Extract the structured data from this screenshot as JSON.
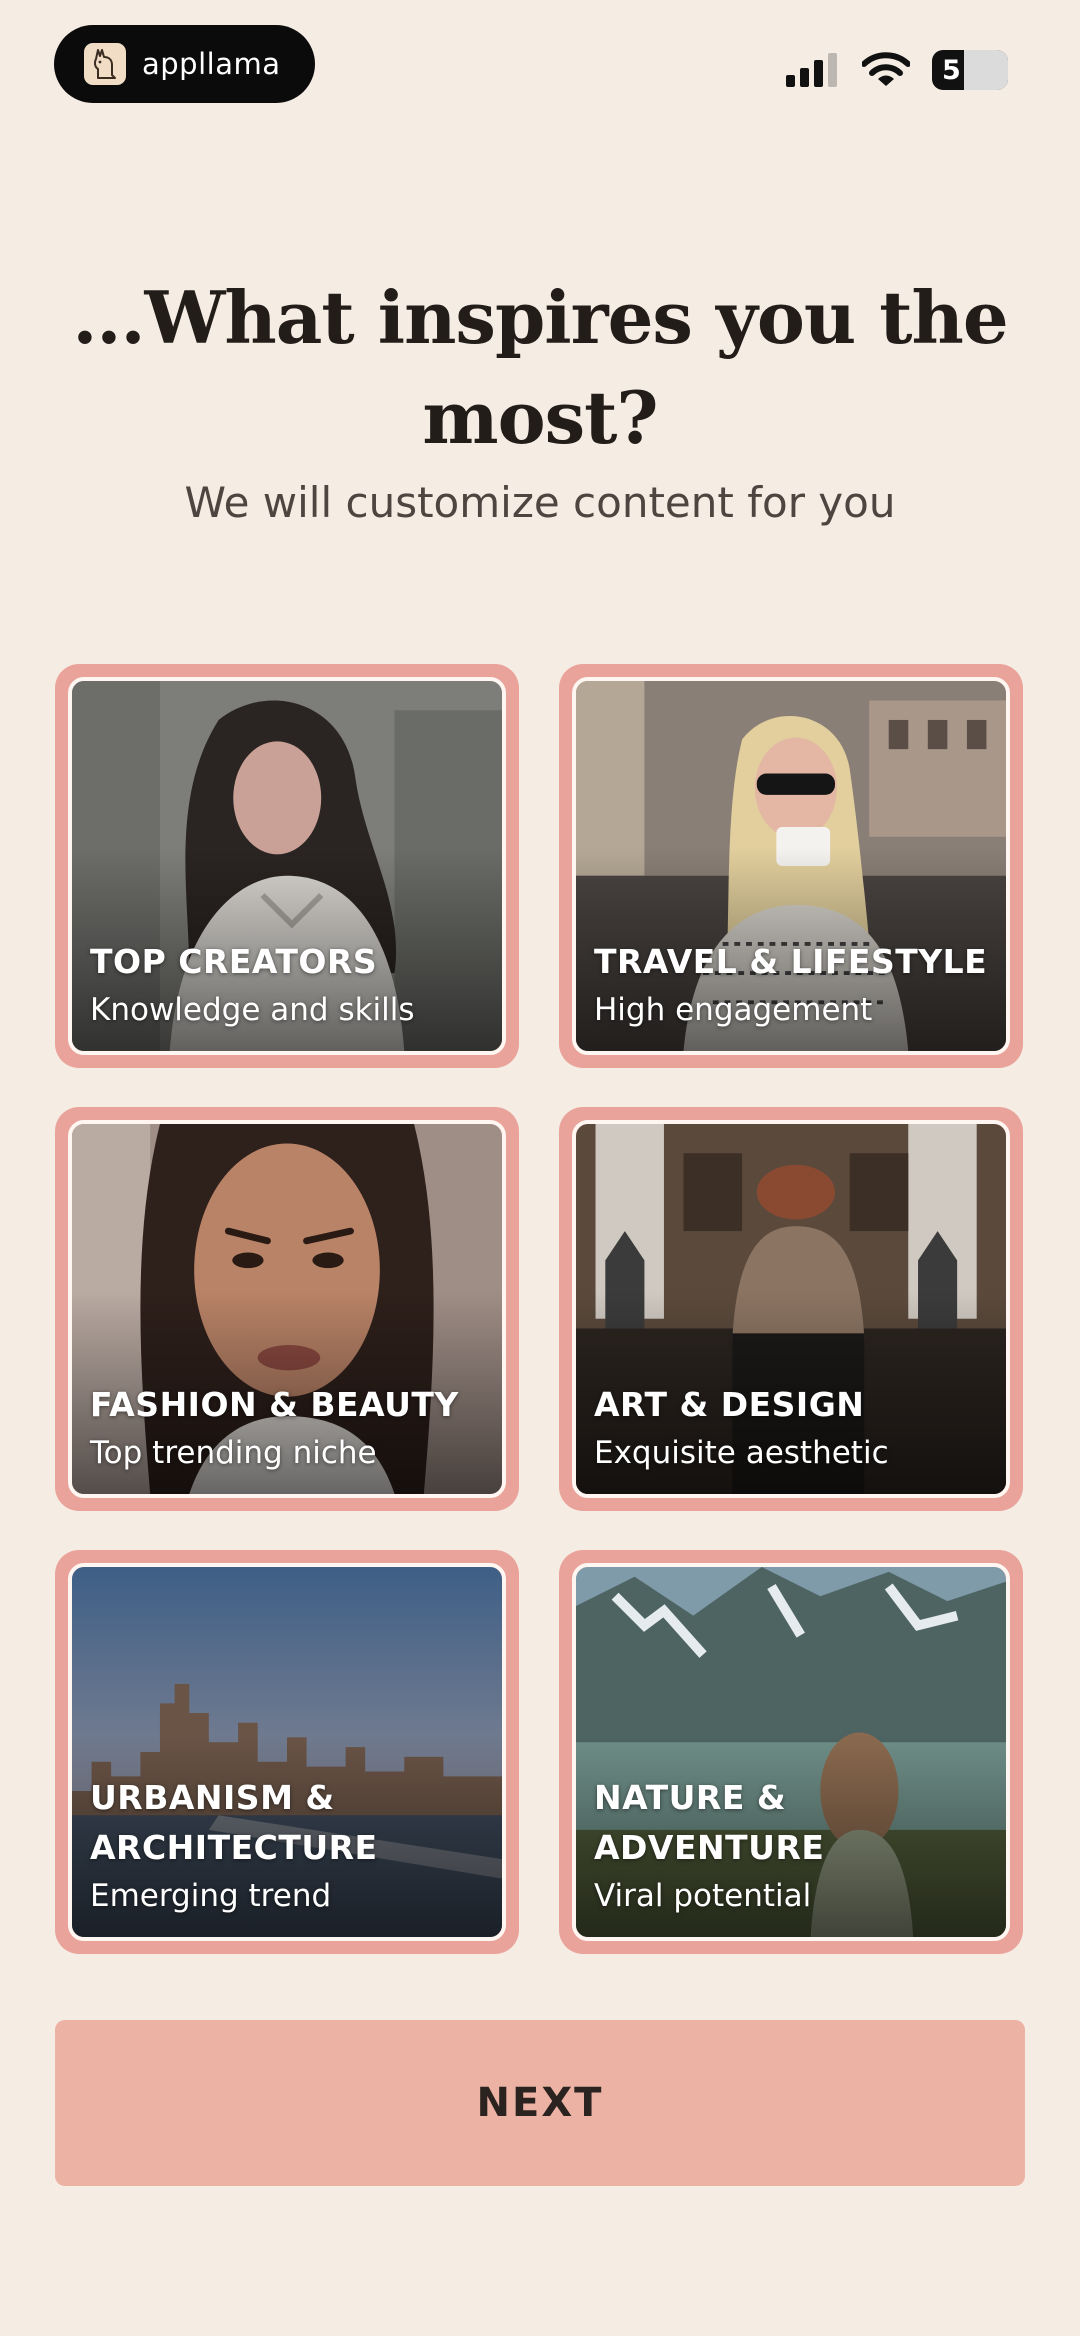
{
  "status_bar": {
    "app_name": "appllama",
    "battery_level": "5"
  },
  "header": {
    "title": "...What inspires you the most?",
    "subtitle": "We will customize content for you"
  },
  "cards": [
    {
      "title": "TOP CREATORS",
      "subtitle": "Knowledge and skills"
    },
    {
      "title": "TRAVEL & LIFESTYLE",
      "subtitle": "High engagement"
    },
    {
      "title": "FASHION & BEAUTY",
      "subtitle": "Top trending niche"
    },
    {
      "title": "ART & DESIGN",
      "subtitle": "Exquisite aesthetic"
    },
    {
      "title": "URBANISM & ARCHITECTURE",
      "subtitle": "Emerging trend"
    },
    {
      "title": "NATURE & ADVENTURE",
      "subtitle": "Viral potential"
    }
  ],
  "footer": {
    "next_label": "NEXT"
  }
}
